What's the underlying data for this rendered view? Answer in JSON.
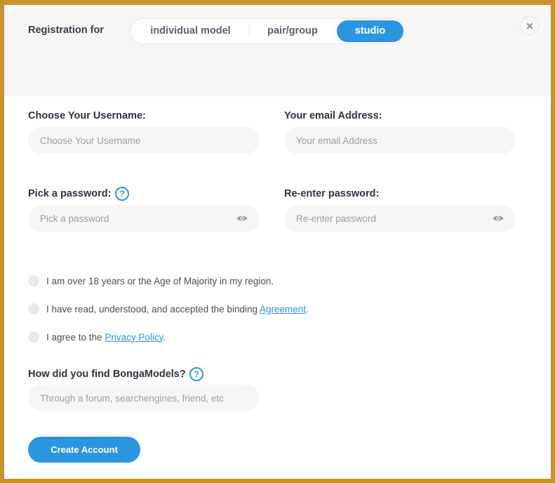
{
  "header": {
    "registration_label": "Registration for",
    "tabs": [
      {
        "label": "individual model",
        "selected": false
      },
      {
        "label": "pair/group",
        "selected": false
      },
      {
        "label": "studio",
        "selected": true
      }
    ],
    "close_icon": "close-icon"
  },
  "form": {
    "username": {
      "label": "Choose Your Username:",
      "placeholder": "Choose Your Username",
      "value": ""
    },
    "email": {
      "label": "Your email Address:",
      "placeholder": "Your email Address",
      "value": ""
    },
    "password": {
      "label": "Pick a password:",
      "placeholder": "Pick a password",
      "value": "",
      "help_icon": "question-circle-icon",
      "toggle_icon": "eye-icon"
    },
    "password_confirm": {
      "label": "Re-enter password:",
      "placeholder": "Re-enter password",
      "value": "",
      "toggle_icon": "eye-icon"
    },
    "checkboxes": [
      {
        "text": "I am over 18 years or the Age of Majority in my region.",
        "checked": false
      },
      {
        "text_before": "I have read, understood, and accepted the binding ",
        "link": "Agreement",
        "text_after": ".",
        "checked": false
      },
      {
        "text_before": "I agree to the ",
        "link": "Privacy Policy",
        "text_after": ".",
        "checked": false
      }
    ],
    "referral": {
      "label": "How did you find BongaModels?",
      "placeholder": "Through a forum, searchengines, friend, etc",
      "value": "",
      "help_icon": "question-circle-icon"
    },
    "submit_label": "Create Account"
  },
  "colors": {
    "accent": "#2b95e0",
    "frame_border": "#c8922e",
    "header_bg": "#f6f6f6",
    "input_bg": "#f6f6f6"
  }
}
